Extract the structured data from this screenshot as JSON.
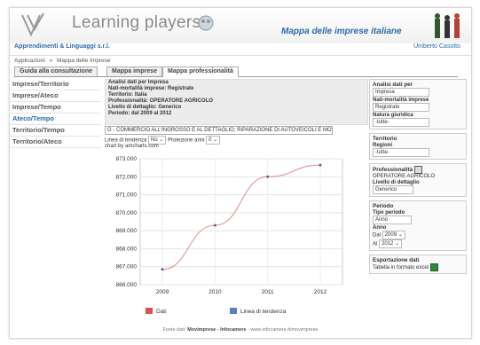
{
  "header": {
    "app_title": "Learning players",
    "tagline": "Mappa delle imprese italiane",
    "company": "Apprendimenti & Linguaggi s.r.l.",
    "user": "Umberto Casotto"
  },
  "breadcrumb": [
    "Applicazioni",
    "»",
    "Mappa delle Imprese"
  ],
  "tabs": [
    {
      "label": "Guida alla consultazione"
    },
    {
      "label": "Mappa imprese"
    },
    {
      "label": "Mappa professionalità"
    }
  ],
  "leftnav": [
    {
      "label": "Imprese/Territorio"
    },
    {
      "label": "Imprese/Ateco"
    },
    {
      "label": "Imprese/Tempo"
    },
    {
      "label": "Ateco/Tempo"
    },
    {
      "label": "Territorio/Tempo"
    },
    {
      "label": "Territorio/Ateco"
    }
  ],
  "info": {
    "line1": "Analisi dati per Impresa",
    "line2": "Nati-mortalità imprese: Registrate",
    "line3": "Territorio: Italia",
    "line4": "Professionalità: OPERATORE AGRICOLO",
    "line5": "Livello di dettaglio: Generico",
    "line6": "Periodo: dal 2009 al 2012"
  },
  "ateco_select": "G - COMMERCIO ALL'INGROSSO E AL DETTAGLIO; RIPARAZIONE DI AUTOVEICOLI E MOT...",
  "trend": {
    "label": "Linea di tendenza",
    "value": "No",
    "proj_label": "Proiezione anni",
    "proj_value": "0"
  },
  "amcharts": "chart by amcharts.com",
  "chart_data": {
    "type": "line",
    "categories": [
      "2009",
      "2010",
      "2011",
      "2012"
    ],
    "series": [
      {
        "name": "Dati",
        "values": [
          866850,
          869300,
          872000,
          872650
        ]
      }
    ],
    "ylim": [
      866000,
      873000
    ],
    "yticks": [
      "873.000",
      "872.000",
      "871.000",
      "870.000",
      "869.000",
      "868.000",
      "867.000",
      "866.000"
    ],
    "legend": [
      {
        "name": "Dati",
        "color": "#d9534f"
      },
      {
        "name": "Linea di tendenza",
        "color": "#5b7fbd"
      }
    ],
    "line_color": "#e08a8a",
    "grid": true
  },
  "rpanel": {
    "analisi_title": "Analisi dati per",
    "analisi_value": "Impresa",
    "nati_label": "Nati-mortalità imprese",
    "nati_value": "Registrate",
    "natura_label": "Natura giuridica",
    "natura_value": "-tutte-",
    "territorio_title": "Territorio",
    "regioni_label": "Regioni",
    "regioni_value": "-tutte-",
    "prof_title": "Professionalità",
    "prof_value": "OPERATORE AGRICOLO",
    "livello_label": "Livello di dettaglio",
    "livello_value": "Generico",
    "periodo_title": "Periodo",
    "tipo_label": "Tipo periodo",
    "tipo_value": "Anno",
    "anno_label": "Anno",
    "dal_label": "Dal",
    "dal_value": "2009",
    "al_label": "Al",
    "al_value": "2012",
    "export_title": "Esportazione dati",
    "export_label": "Tabella in formato excel"
  },
  "footer": {
    "prefix": "Fonte dati:",
    "source": "Movimprese - Infocamere",
    "url": "www.infocamere.it/movimprese"
  }
}
